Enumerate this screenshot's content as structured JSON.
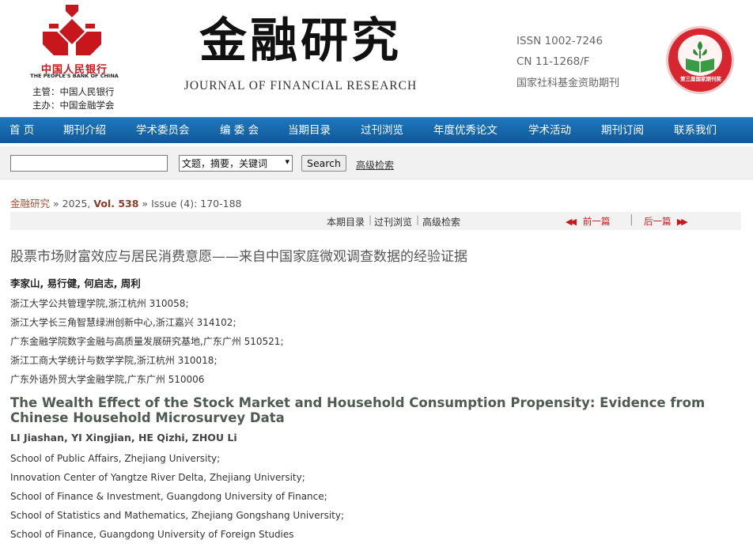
{
  "header": {
    "pboc_name_cn": "中国人民银行",
    "pboc_name_en": "THE PEOPLE'S BANK OF CHINA",
    "sponsor_line": "主管：中国人民银行",
    "host_line": "主办：中国金融学会",
    "journal_title_cn": "金融研究",
    "journal_title_en": "JOURNAL OF FINANCIAL RESEARCH",
    "issn": "ISSN 1002-7246",
    "cn": "CN 11-1268/F",
    "funding_note": "国家社科基金资助期刊",
    "badge_text": "第三届国家期刊奖",
    "brand_color": "#c8161d"
  },
  "nav": {
    "items": [
      "首 页",
      "期刊介绍",
      "学术委员会",
      "编 委 会",
      "当期目录",
      "过刊浏览",
      "年度优秀论文",
      "学术活动",
      "期刊订阅",
      "联系我们"
    ],
    "background": "#1565a8"
  },
  "search": {
    "input_value": "",
    "scope_selected": "文题，摘要，关键词",
    "button_label": "Search",
    "advanced_label": "高级检索"
  },
  "breadcrumb": {
    "journal": "金融研究",
    "sep1": " » ",
    "year": "2025, ",
    "vol": "Vol. 538",
    "sep2": " » ",
    "issue": "Issue (4): 170-188"
  },
  "toolbar": {
    "current_issue": "本期目录",
    "archive": "过刊浏览",
    "advanced": "高级检索",
    "prev": "前一篇",
    "next": "后一篇",
    "separator": "|"
  },
  "article": {
    "title_cn": "股票市场财富效应与居民消费意愿——来自中国家庭微观调查数据的经验证据",
    "authors_cn": "李家山, 易行健, 何启志, 周利",
    "affiliations_cn": [
      "浙江大学公共管理学院,浙江杭州 310058;",
      "浙江大学长三角智慧绿洲创新中心,浙江嘉兴 314102;",
      "广东金融学院数字金融与高质量发展研究基地,广东广州 510521;",
      "浙江工商大学统计与数学学院,浙江杭州 310018;",
      "广东外语外贸大学金融学院,广东广州 510006"
    ],
    "title_en": "The Wealth Effect of the Stock Market and Household Consumption Propensity: Evidence from Chinese Household Microsurvey Data",
    "authors_en": "LI Jiashan, YI Xingjian, HE Qizhi, ZHOU Li",
    "affiliations_en": [
      "School of Public Affairs, Zhejiang University;",
      "Innovation Center of Yangtze River Delta, Zhejiang University;",
      "School of Finance & Investment, Guangdong University of Finance;",
      "School of Statistics and Mathematics, Zhejiang Gongshang University;",
      "School of Finance, Guangdong University of Foreign Studies"
    ]
  }
}
